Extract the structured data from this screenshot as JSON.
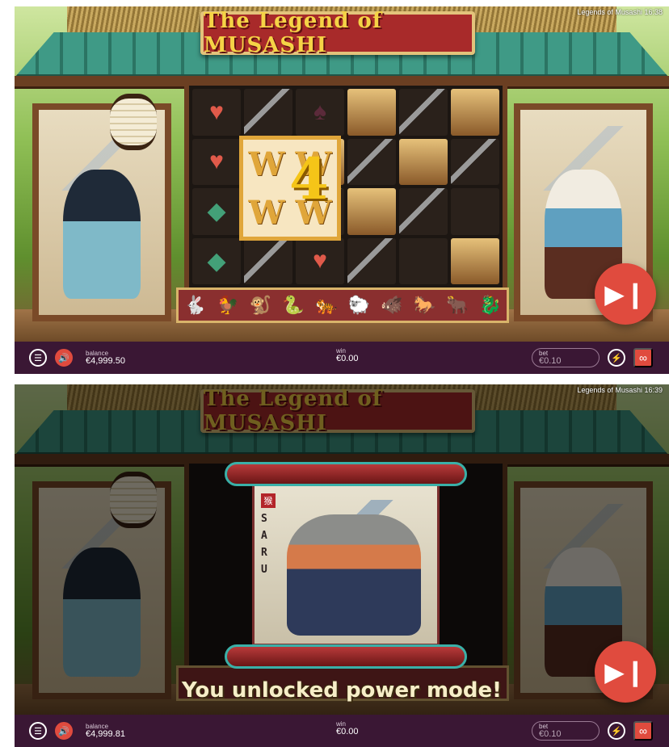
{
  "game_title": "The Legend of MUSASHI",
  "frames": [
    {
      "status_bar": {
        "app_name": "Legends of Musashi",
        "time": "16:38"
      },
      "reel_symbols": [
        [
          "♥",
          "",
          "♠",
          "",
          "",
          ""
        ],
        [
          "♥",
          "",
          "",
          "",
          "",
          ""
        ],
        [
          "◆",
          "",
          "",
          "",
          "",
          ""
        ],
        [
          "◆",
          "",
          "♥",
          "",
          "",
          ""
        ]
      ],
      "wild_letters": [
        "W",
        "W",
        "W",
        "W"
      ],
      "win_multiplier": "4",
      "zodiac_icons": [
        "🐇",
        "🐓",
        "🐒",
        "🐍",
        "🐅",
        "🐑",
        "🐗",
        "🐎",
        "🐂",
        "🐉"
      ],
      "controls": {
        "balance_label": "balance",
        "balance_value": "€4,999.50",
        "win_label": "win",
        "win_value": "€0.00",
        "bet_label": "bet",
        "bet_value": "€0.10",
        "menu_icon": "☰",
        "sound_icon": "🔊",
        "turbo_icon": "⚡",
        "auto_icon": "∞",
        "spin_icon": "▶❙"
      }
    },
    {
      "status_bar": {
        "app_name": "Legends of Musashi",
        "time": "16:39"
      },
      "scroll": {
        "seal_char": "猴",
        "letters": [
          "S",
          "A",
          "R",
          "U"
        ]
      },
      "announcement": "You unlocked power mode!",
      "controls": {
        "balance_label": "balance",
        "balance_value": "€4,999.81",
        "win_label": "win",
        "win_value": "€0.00",
        "bet_label": "bet",
        "bet_value": "€0.10",
        "menu_icon": "☰",
        "sound_icon": "🔊",
        "turbo_icon": "⚡",
        "auto_icon": "∞",
        "spin_icon": "▶❙"
      }
    }
  ],
  "colors": {
    "accent_red": "#e04b3e",
    "control_bar": "#3a1734",
    "title_gold": "#f5d346",
    "roof_teal": "#3f9a86"
  }
}
